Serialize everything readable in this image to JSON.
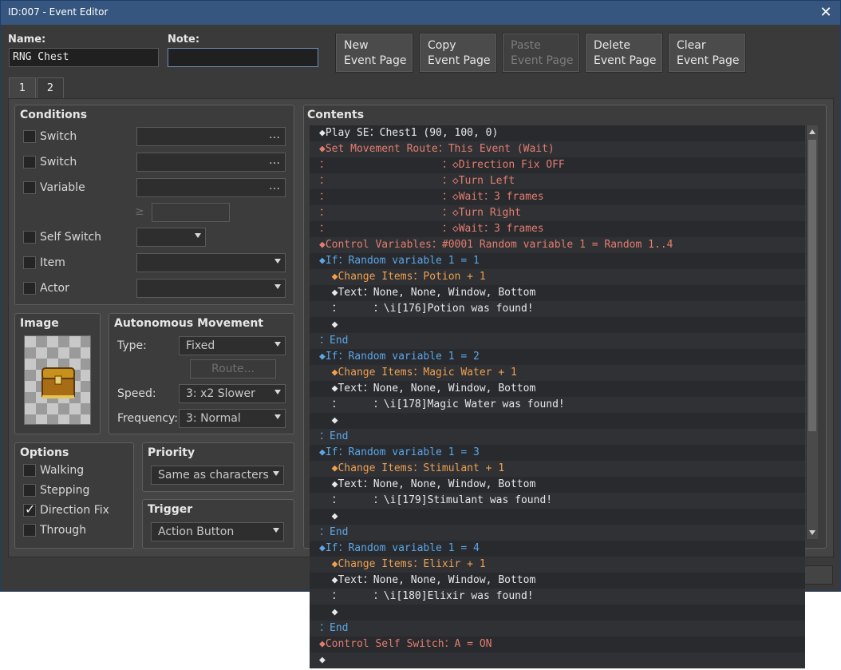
{
  "window": {
    "title": "ID:007 - Event Editor",
    "close_glyph": "✕"
  },
  "header": {
    "name_label": "Name:",
    "name_value": "RNG Chest",
    "note_label": "Note:",
    "note_value": "",
    "buttons": [
      {
        "line1": "New",
        "line2": "Event Page",
        "enabled": true
      },
      {
        "line1": "Copy",
        "line2": "Event Page",
        "enabled": true
      },
      {
        "line1": "Paste",
        "line2": "Event Page",
        "enabled": false
      },
      {
        "line1": "Delete",
        "line2": "Event Page",
        "enabled": true
      },
      {
        "line1": "Clear",
        "line2": "Event Page",
        "enabled": true
      }
    ]
  },
  "tabs": [
    "1",
    "2"
  ],
  "conditions": {
    "title": "Conditions",
    "switch1": "Switch",
    "switch2": "Switch",
    "variable": "Variable",
    "gte": "≥",
    "self_switch": "Self Switch",
    "item": "Item",
    "actor": "Actor"
  },
  "image": {
    "title": "Image",
    "icon": "treasure-chest-icon"
  },
  "movement": {
    "title": "Autonomous Movement",
    "type_label": "Type:",
    "type_value": "Fixed",
    "route_button": "Route...",
    "speed_label": "Speed:",
    "speed_value": "3: x2 Slower",
    "frequency_label": "Frequency:",
    "frequency_value": "3: Normal"
  },
  "options": {
    "title": "Options",
    "items": [
      {
        "label": "Walking",
        "checked": false
      },
      {
        "label": "Stepping",
        "checked": false
      },
      {
        "label": "Direction Fix",
        "checked": true
      },
      {
        "label": "Through",
        "checked": false
      }
    ]
  },
  "priority": {
    "title": "Priority",
    "value": "Same as characters"
  },
  "trigger": {
    "title": "Trigger",
    "value": "Action Button"
  },
  "contents": {
    "title": "Contents",
    "lines": [
      {
        "text": "◆Play SE：Chest1 (90, 100, 0)",
        "color": "white"
      },
      {
        "text": "◆Set Movement Route：This Event (Wait)",
        "color": "red"
      },
      {
        "text": "：                  ：◇Direction Fix OFF",
        "color": "red"
      },
      {
        "text": "：                  ：◇Turn Left",
        "color": "red"
      },
      {
        "text": "：                  ：◇Wait：3 frames",
        "color": "red"
      },
      {
        "text": "：                  ：◇Turn Right",
        "color": "red"
      },
      {
        "text": "：                  ：◇Wait：3 frames",
        "color": "red"
      },
      {
        "text": "◆Control Variables：#0001 Random variable 1 = Random 1..4",
        "color": "red"
      },
      {
        "text": "◆If：Random variable 1 = 1",
        "color": "blue"
      },
      {
        "text": "  ◆Change Items：Potion + 1",
        "color": "orange"
      },
      {
        "text": "  ◆Text：None, None, Window, Bottom",
        "color": "white"
      },
      {
        "text": "  ：     ：\\i[176]Potion was found!",
        "color": "white"
      },
      {
        "text": "  ◆",
        "color": "white"
      },
      {
        "text": "：End",
        "color": "blue"
      },
      {
        "text": "◆If：Random variable 1 = 2",
        "color": "blue"
      },
      {
        "text": "  ◆Change Items：Magic Water + 1",
        "color": "orange"
      },
      {
        "text": "  ◆Text：None, None, Window, Bottom",
        "color": "white"
      },
      {
        "text": "  ：     ：\\i[178]Magic Water was found!",
        "color": "white"
      },
      {
        "text": "  ◆",
        "color": "white"
      },
      {
        "text": "：End",
        "color": "blue"
      },
      {
        "text": "◆If：Random variable 1 = 3",
        "color": "blue"
      },
      {
        "text": "  ◆Change Items：Stimulant + 1",
        "color": "orange"
      },
      {
        "text": "  ◆Text：None, None, Window, Bottom",
        "color": "white"
      },
      {
        "text": "  ：     ：\\i[179]Stimulant was found!",
        "color": "white"
      },
      {
        "text": "  ◆",
        "color": "white"
      },
      {
        "text": "：End",
        "color": "blue"
      },
      {
        "text": "◆If：Random variable 1 = 4",
        "color": "blue"
      },
      {
        "text": "  ◆Change Items：Elixir + 1",
        "color": "orange"
      },
      {
        "text": "  ◆Text：None, None, Window, Bottom",
        "color": "white"
      },
      {
        "text": "  ：     ：\\i[180]Elixir was found!",
        "color": "white"
      },
      {
        "text": "  ◆",
        "color": "white"
      },
      {
        "text": "：End",
        "color": "blue"
      },
      {
        "text": "◆Control Self Switch：A = ON",
        "color": "red"
      },
      {
        "text": "◆",
        "color": "white"
      }
    ]
  },
  "colors": {
    "titlebar": "#36567f",
    "command_red": "#e57d6e",
    "command_orange": "#f0a050",
    "command_blue": "#5aa6e8"
  }
}
